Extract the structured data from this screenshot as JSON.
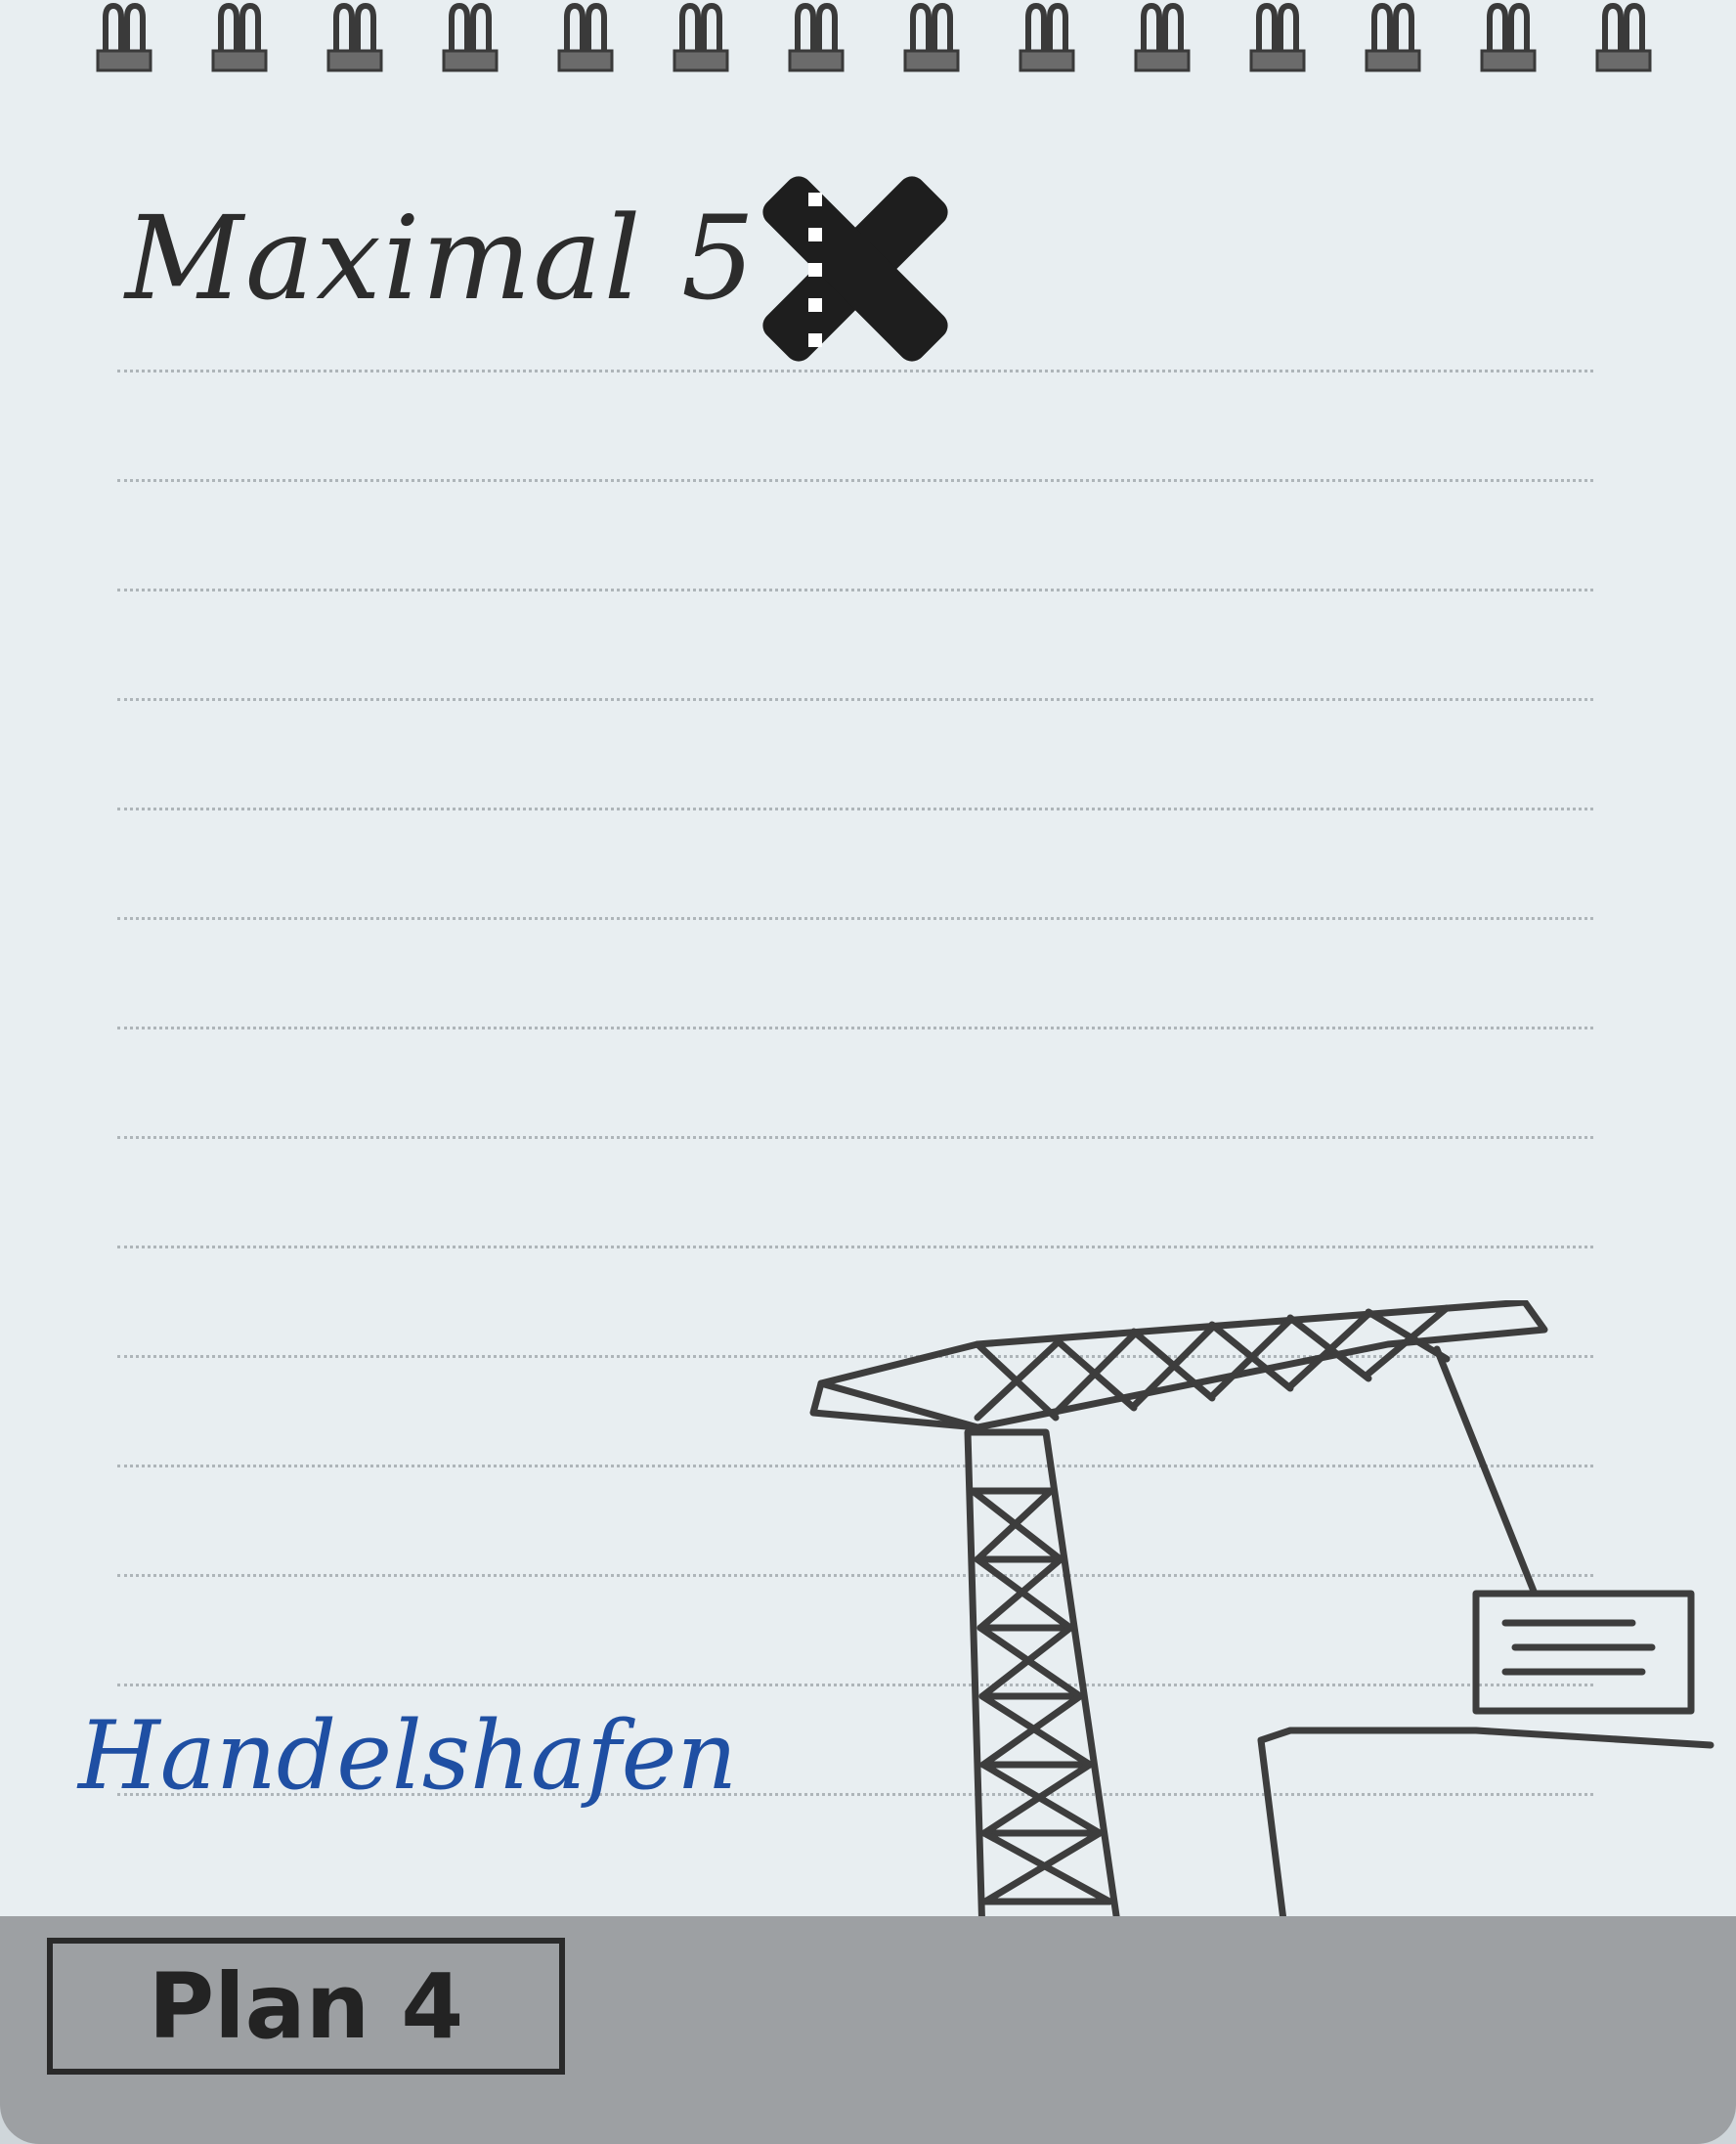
{
  "card": {
    "title": "Maximal 5",
    "icon": "cross-marker-icon",
    "subtitle": "Handelshafen",
    "plan_label": "Plan 4"
  },
  "illustration": {
    "icon": "harbor-crane-icon"
  },
  "colors": {
    "paper": "#e8eef1",
    "ink": "#2c2c2c",
    "blue_ink": "#1f4fa3",
    "band": "#9da0a3"
  }
}
